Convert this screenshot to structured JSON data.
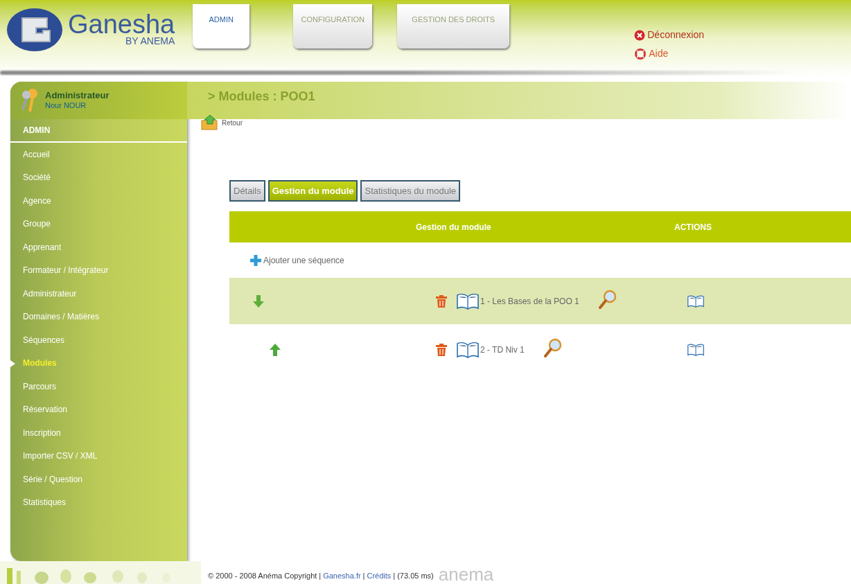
{
  "logo": {
    "name": "Ganesha",
    "tagline": "BY ANEMA"
  },
  "top_tabs": [
    {
      "label": "ADMIN",
      "selected": true
    },
    {
      "label": "CONFIGURATION",
      "selected": false
    },
    {
      "label": "GESTION DES DROITS",
      "selected": false
    }
  ],
  "header_links": [
    {
      "kind": "logout",
      "label": "Déconnexion"
    },
    {
      "kind": "help",
      "label": "Aide"
    }
  ],
  "user": {
    "role": "Administrateur",
    "name": "Nour NOUR"
  },
  "sidebar": {
    "section": "ADMIN",
    "items": [
      {
        "label": "Accueil",
        "selected": false
      },
      {
        "label": "Société",
        "selected": false
      },
      {
        "label": "Agence",
        "selected": false
      },
      {
        "label": "Groupe",
        "selected": false
      },
      {
        "label": "Apprenant",
        "selected": false
      },
      {
        "label": "Formateur / Intégrateur",
        "selected": false
      },
      {
        "label": "Administrateur",
        "selected": false
      },
      {
        "label": "Domaines / Matières",
        "selected": false
      },
      {
        "label": "Séquences",
        "selected": false
      },
      {
        "label": "Modules",
        "selected": true
      },
      {
        "label": "Parcours",
        "selected": false
      },
      {
        "label": "Réservation",
        "selected": false
      },
      {
        "label": "Inscription",
        "selected": false
      },
      {
        "label": "Importer CSV / XML",
        "selected": false
      },
      {
        "label": "Série / Question",
        "selected": false
      },
      {
        "label": "Statistiques",
        "selected": false
      }
    ]
  },
  "page_title": "> Modules : POO1",
  "back_link": "Retour",
  "tabs": [
    {
      "label": "Détails",
      "selected": false
    },
    {
      "label": "Gestion du module",
      "selected": true
    },
    {
      "label": "Statistiques du module",
      "selected": false
    }
  ],
  "table": {
    "columns": [
      "Gestion du module",
      "ACTIONS"
    ],
    "add_link": "Ajouter une séquence",
    "rows": [
      {
        "kind": "down",
        "label": "1 - Les Bases de la POO 1"
      },
      {
        "kind": "up",
        "label": "2 - TD Niv 1"
      }
    ]
  },
  "footer": {
    "copyright": "© 2000 - 2008 Anéma Copyright",
    "separator": "|",
    "links": [
      "Ganesha.fr",
      "Crédits"
    ],
    "timing": "(73.05 ms)",
    "logo": "anema"
  }
}
